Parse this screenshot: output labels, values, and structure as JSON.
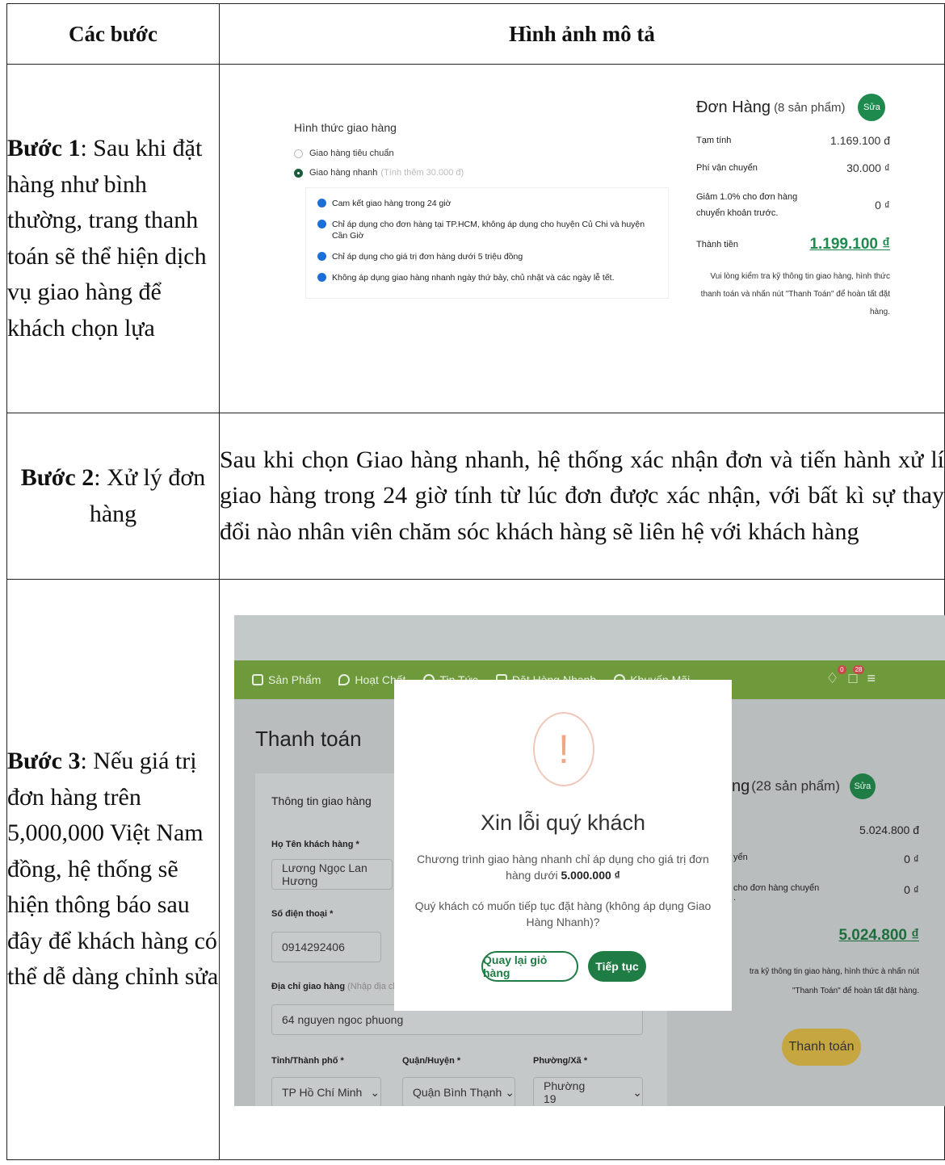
{
  "table": {
    "headers": {
      "col1": "Các bước",
      "col2": "Hình ảnh mô tả"
    },
    "rows": [
      {
        "step_bold": "Bước 1",
        "step_text": ": Sau khi đặt hàng như bình thường, trang thanh toán sẽ thể hiện dịch vụ giao hàng để khách chọn lựa"
      },
      {
        "step_bold": "Bước 2",
        "step_text": ": Xử lý đơn hàng",
        "description": "Sau khi chọn Giao hàng nhanh, hệ thống xác nhận đơn và tiến hành xử lí giao hàng trong 24 giờ tính từ lúc đơn được xác nhận, với bất kì sự thay đổi nào nhân viên chăm sóc khách hàng sẽ liên hệ với khách hàng"
      },
      {
        "step_bold": "Bước 3",
        "step_text": ": Nếu giá trị đơn hàng trên 5,000,000 Việt Nam đồng, hệ thống sẽ hiện thông báo sau đây để khách hàng có thể dễ dàng chỉnh sửa"
      }
    ]
  },
  "shot1": {
    "shipping_title": "Hình thức giao hàng",
    "options": [
      {
        "label": "Giao hàng tiêu chuẩn",
        "note": "",
        "selected": false
      },
      {
        "label": "Giao hàng nhanh",
        "note": "(Tính thêm 30.000 đ)",
        "selected": true
      }
    ],
    "info_icon_color": "#1d6fd8",
    "info": [
      "Cam kết giao hàng trong 24 giờ",
      "Chỉ áp dụng cho đơn hàng tại TP.HCM, không áp dụng cho huyện Củ Chi và huyện Cần Giờ",
      "Chỉ áp dụng cho giá trị đơn hàng dưới 5 triệu đồng",
      "Không áp dụng giao hàng nhanh ngày thứ bảy, chủ nhật và các ngày lễ tết."
    ],
    "order": {
      "title": "Đơn Hàng",
      "count": "(8 sản phẩm)",
      "edit": "Sửa",
      "rows": [
        {
          "label": "Tạm tính",
          "value": "1.169.100 đ"
        },
        {
          "label": "Phí vận chuyển",
          "value": "30.000 ₫"
        },
        {
          "label": "Giảm 1.0% cho đơn hàng chuyển khoản trước.",
          "value": "0 ₫"
        },
        {
          "label": "Thành tiền",
          "value": "1.199.100 ₫"
        }
      ],
      "note": "Vui lòng kiểm tra kỹ thông tin giao hàng, hình thức thanh toán và nhấn nút \"Thanh Toán\" để hoàn tất đặt hàng."
    }
  },
  "shot2": {
    "brand_color": "#6f9a3b",
    "nav": [
      "Sản Phẩm",
      "Hoạt Chất",
      "Tin Tức",
      "Đặt Hàng Nhanh",
      "Khuyến Mãi"
    ],
    "bell_badge": "0",
    "cart_badge": "28",
    "page_title": "Thanh toán",
    "form": {
      "section": "Thông tin giao hàng",
      "name_label": "Họ Tên khách hàng *",
      "name_value": "Lương Ngọc Lan Hương",
      "phone_label": "Số điện thoại *",
      "phone_value": "0914292406",
      "address_label": "Địa chỉ giao hàng",
      "address_hint": "(Nhập địa chỉ",
      "address_value": "64 nguyen ngoc phuong",
      "city_label": "Tỉnh/Thành phố *",
      "city_value": "TP Hồ Chí Minh",
      "district_label": "Quận/Huyện *",
      "district_value": "Quận Bình Thạnh",
      "ward_label": "Phường/Xã *",
      "ward_value": "Phường 19"
    },
    "order": {
      "title_tail": "ng",
      "count": "(28 sản phẩm)",
      "edit": "Sửa",
      "subtotal": "5.024.800 đ",
      "ship_label": "yển",
      "ship_value": "0 ₫",
      "discount_label": "cho đơn hàng chuyển",
      "discount_label2": ".",
      "discount_value": "0 ₫",
      "total": "5.024.800 ₫",
      "note": "tra kỹ thông tin giao hàng, hình thức à nhấn nút \"Thanh Toán\" để hoàn tất đặt hàng.",
      "pay_button": "Thanh toán"
    },
    "modal": {
      "icon": "!",
      "title": "Xin lỗi quý khách",
      "line1": "Chương trình giao hàng nhanh chỉ áp dụng cho giá trị đơn hàng dưới",
      "line1_bold": "5.000.000 ₫",
      "line2": "Quý khách có muốn tiếp tục đặt hàng (không áp dụng Giao Hàng Nhanh)?",
      "back_button": "Quay lại giỏ hàng",
      "continue_button": "Tiếp tục"
    }
  }
}
